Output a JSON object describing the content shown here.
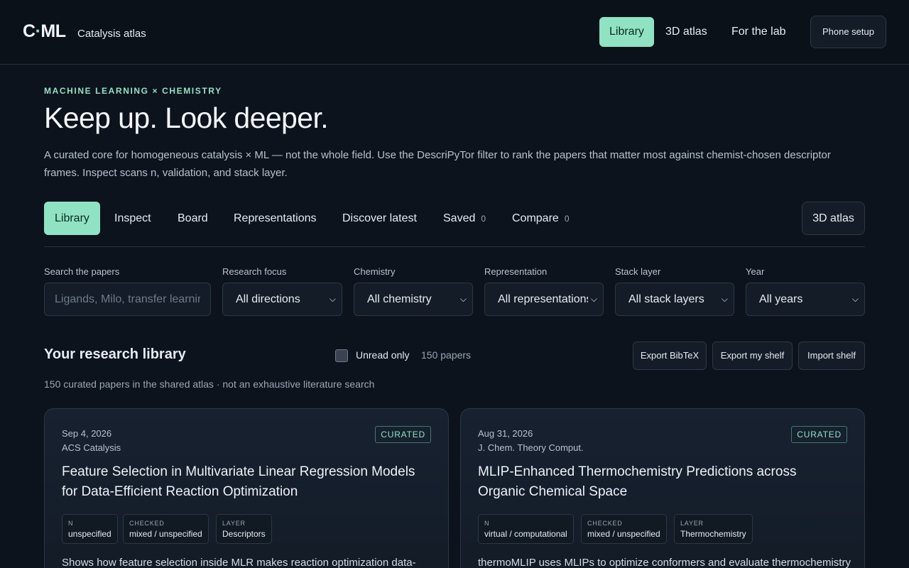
{
  "header": {
    "logo_left": "C",
    "logo_dot": "·",
    "logo_right": "ML",
    "app_title": "Catalysis atlas",
    "nav": [
      "Library",
      "3D atlas",
      "For the lab"
    ],
    "phone_setup": "Phone setup"
  },
  "hero": {
    "eyebrow": "MACHINE LEARNING × CHEMISTRY",
    "headline": "Keep up. Look deeper.",
    "lede": "A curated core for homogeneous catalysis × ML — not the whole field. Use the DescriPyTor filter to rank the papers that matter most against chemist-chosen descriptor frames. Inspect scans n, validation, and stack layer."
  },
  "tabs": {
    "items": [
      "Library",
      "Inspect",
      "Board",
      "Representations",
      "Discover latest"
    ],
    "saved_label": "Saved",
    "saved_count": "0",
    "compare_label": "Compare",
    "compare_count": "0",
    "atlas": "3D atlas"
  },
  "filters": {
    "search_label": "Search the papers",
    "search_placeholder": "Ligands, Milo, transfer learning",
    "focus_label": "Research focus",
    "focus_value": "All directions",
    "chemistry_label": "Chemistry",
    "chemistry_value": "All chemistry",
    "representation_label": "Representation",
    "representation_value": "All representations",
    "stack_label": "Stack layer",
    "stack_value": "All stack layers",
    "year_label": "Year",
    "year_value": "All years"
  },
  "library": {
    "title": "Your research library",
    "unread_label": "Unread only",
    "unread_checked": false,
    "count": "150 papers",
    "export_bibtex": "Export BibTeX",
    "export_shelf": "Export my shelf",
    "import_shelf": "Import shelf",
    "note": "150 curated papers in the shared atlas · not an exhaustive literature search"
  },
  "cards": [
    {
      "date": "Sep 4, 2026",
      "venue": "ACS Catalysis",
      "badge": "CURATED",
      "title": "Feature Selection in Multivariate Linear Regression Models for Data-Efficient Reaction Optimization",
      "chips": [
        {
          "k": "N",
          "v": "unspecified"
        },
        {
          "k": "CHECKED",
          "v": "mixed / unspecified"
        },
        {
          "k": "LAYER",
          "v": "Descriptors"
        }
      ],
      "desc": "Shows how feature selection inside MLR makes reaction optimization data-"
    },
    {
      "date": "Aug 31, 2026",
      "venue": "J. Chem. Theory Comput.",
      "badge": "CURATED",
      "title": "MLIP-Enhanced Thermochemistry Predictions across Organic Chemical Space",
      "chips": [
        {
          "k": "N",
          "v": "virtual / computational"
        },
        {
          "k": "CHECKED",
          "v": "mixed / unspecified"
        },
        {
          "k": "LAYER",
          "v": "Thermochemistry"
        }
      ],
      "desc": "thermoMLIP uses MLIPs to optimize conformers and evaluate thermochemistry"
    }
  ],
  "colors": {
    "background": "#0d131c",
    "accent": "#8fe3c2",
    "border": "#2c3846"
  }
}
